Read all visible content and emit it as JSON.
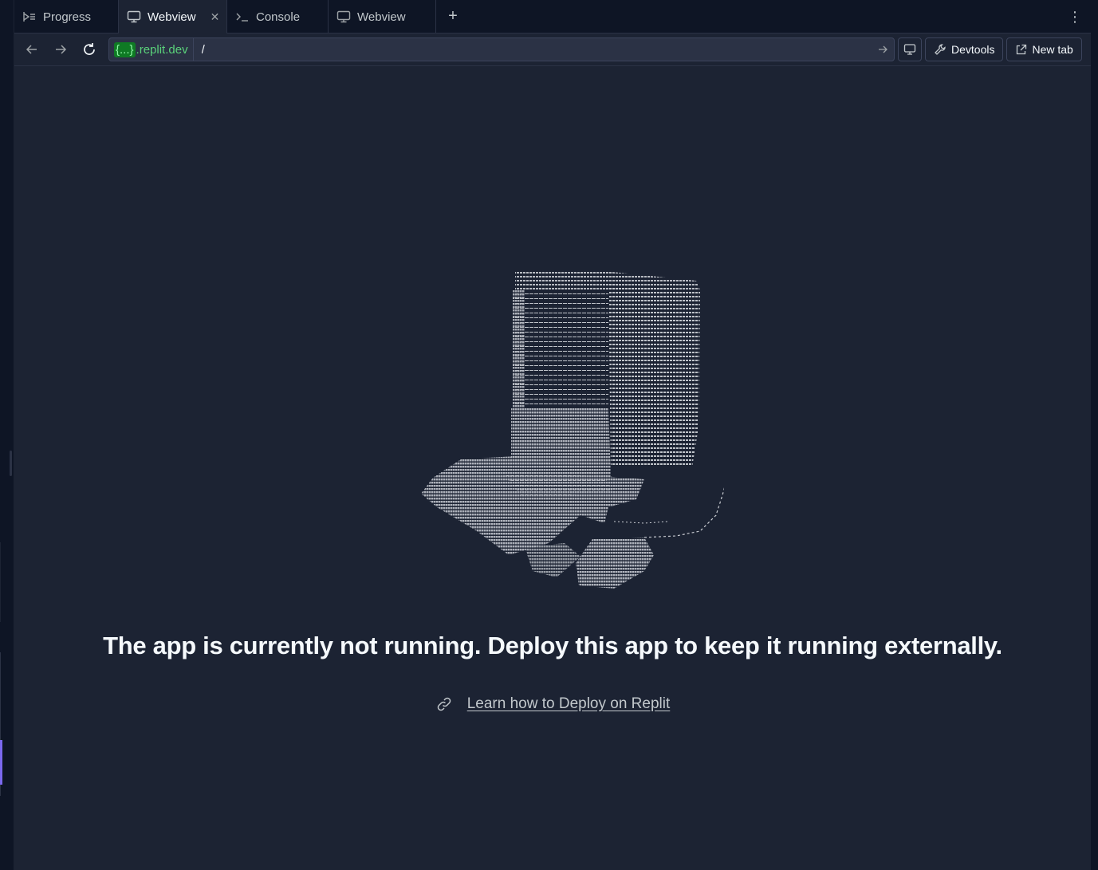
{
  "tabs": [
    {
      "label": "Progress",
      "icon": "progress-icon",
      "active": false
    },
    {
      "label": "Webview",
      "icon": "monitor-icon",
      "active": true,
      "closable": true
    },
    {
      "label": "Console",
      "icon": "terminal-icon",
      "active": false
    },
    {
      "label": "Webview",
      "icon": "monitor-icon",
      "active": false
    }
  ],
  "tab_add_label": "+",
  "toolbar": {
    "url_host_pill": "{...}",
    "url_host_domain": ".replit.dev",
    "url_path": "/",
    "devtools_label": "Devtools",
    "new_tab_label": "New tab"
  },
  "main": {
    "headline": "The app is currently not running. Deploy this app to keep it running externally.",
    "learn_link": "Learn how to Deploy on Replit"
  },
  "colors": {
    "background": "#1c2333",
    "chrome": "#0e1525",
    "host_green": "#5ad27a",
    "accent": "#7b68ee"
  }
}
